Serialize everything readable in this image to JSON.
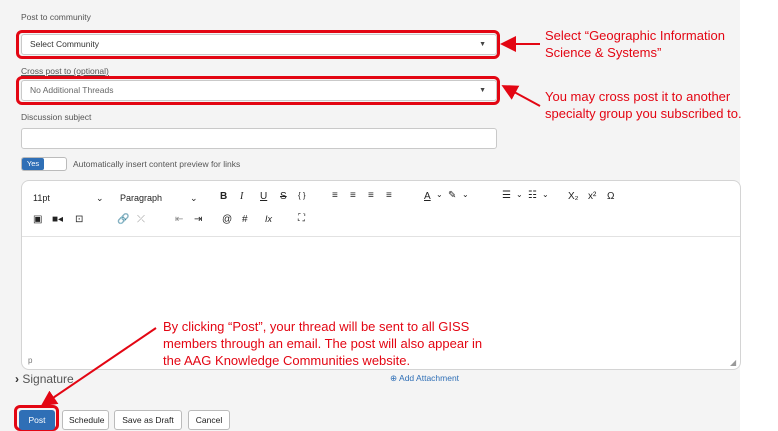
{
  "form": {
    "community_label": "Post to community",
    "community_value": "Select Community",
    "cross_post_label": "Cross post to (optional)",
    "cross_post_value": "No Additional Threads",
    "subject_label": "Discussion subject",
    "subject_value": "",
    "toggle_label": "Yes",
    "toggle_text": "Automatically insert content preview for links"
  },
  "toolbar": {
    "font_size": "11pt",
    "block_format": "Paragraph",
    "bold": "B",
    "italic": "I",
    "underline": "U",
    "strike": "S",
    "superscript": "x²",
    "subscript": "X₂",
    "omega": "Ω",
    "mention": "@",
    "hashtag": "#",
    "clear_format": "Ix"
  },
  "editor": {
    "status_path": "p"
  },
  "signature": {
    "label": "Signature"
  },
  "attachment": {
    "label": "Add Attachment"
  },
  "actions": {
    "post": "Post",
    "schedule": "Schedule",
    "save_draft": "Save as Draft",
    "cancel": "Cancel"
  },
  "annotations": {
    "a1_line1": "Select “Geographic Information",
    "a1_line2": "Science & Systems”",
    "a2_line1": "You may cross post it to another",
    "a2_line2": "specialty group you subscribed to.",
    "a3_line1": "By clicking “Post”, your thread will be sent to all GISS",
    "a3_line2": "members through an email. The post will also appear in",
    "a3_line3": "the AAG Knowledge Communities website."
  },
  "colors": {
    "annotation_red": "#e30613",
    "primary_blue": "#2f6fb6"
  }
}
